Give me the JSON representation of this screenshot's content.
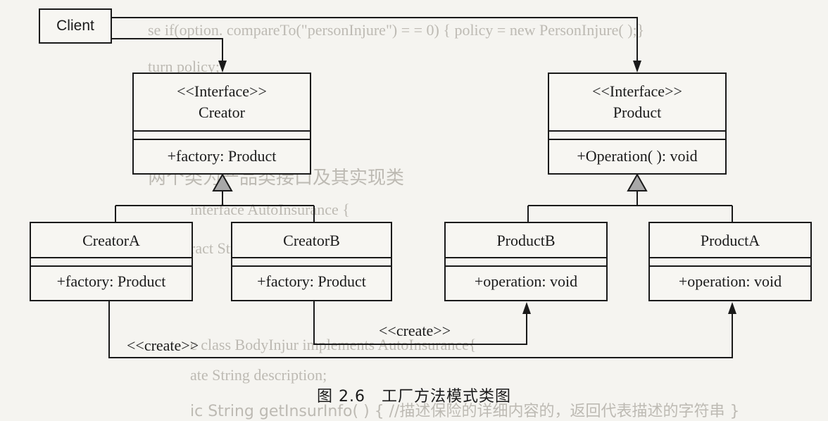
{
  "diagram": {
    "client": {
      "label": "Client"
    },
    "creator_interface": {
      "stereotype": "<<Interface>>",
      "name": "Creator",
      "members": [
        "+factory: Product"
      ]
    },
    "product_interface": {
      "stereotype": "<<Interface>>",
      "name": "Product",
      "members": [
        "+Operation( ): void"
      ]
    },
    "creator_a": {
      "name": "CreatorA",
      "members": [
        "+factory: Product"
      ]
    },
    "creator_b": {
      "name": "CreatorB",
      "members": [
        "+factory: Product"
      ]
    },
    "product_b": {
      "name": "ProductB",
      "members": [
        "+operation: void"
      ]
    },
    "product_a": {
      "name": "ProductA",
      "members": [
        "+operation: void"
      ]
    },
    "relations": {
      "create_a_label": "<<create>>",
      "create_b_label": "<<create>>"
    },
    "caption": "图 2.6　工厂方法模式类图"
  },
  "background_text": [
    "se if(option. compareTo(\"personInjure\") = = 0) { policy = new PersonInjure( );}",
    "turn policy;",
    "两个类为产品类接口及其实现类",
    "interface AutoInsurance {",
    "ract String getInsurInfo( );",
    "c class BodyInjur implements AutoInsurance{",
    "ate String description;",
    "ic String getInsurInfo( ) { //描述保险的详细内容的，返回代表描述的字符串 }"
  ],
  "colors": {
    "line": "#1a1a1a",
    "arrow_fill": "#a8a8a8",
    "ghost_text": "#bdbab3"
  }
}
